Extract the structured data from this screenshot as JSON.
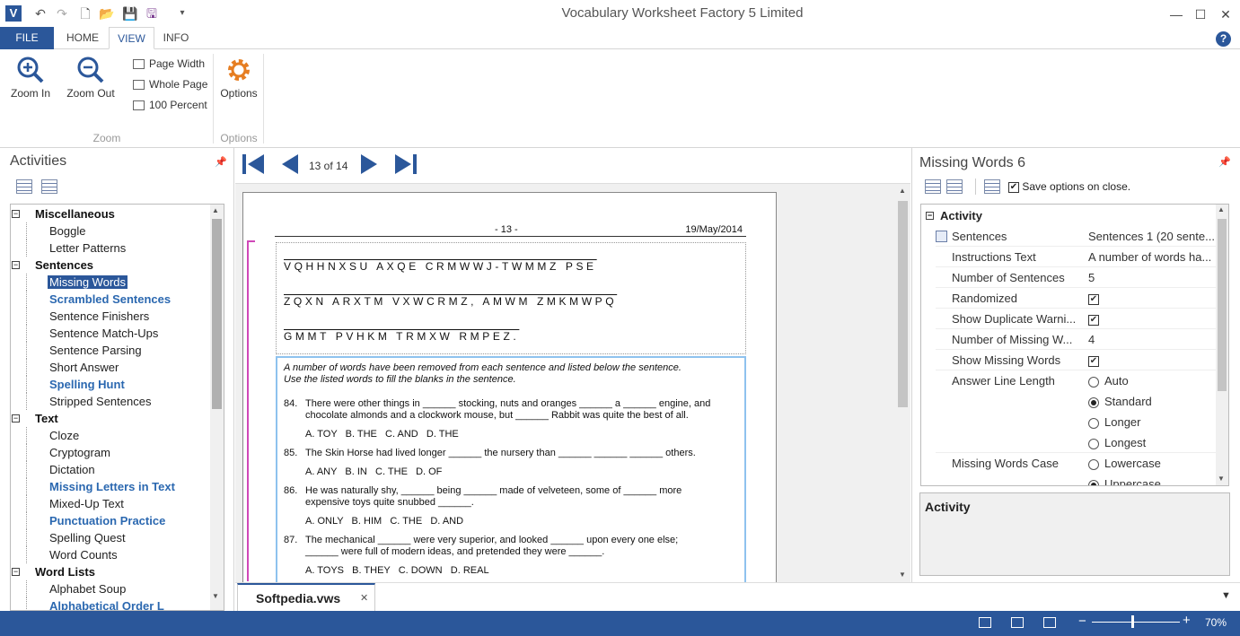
{
  "window": {
    "title": "Vocabulary Worksheet Factory 5 Limited",
    "app_icon": "V",
    "accent": "#2b579a"
  },
  "qat": {
    "icons": [
      "undo-icon",
      "redo-icon",
      "new-icon",
      "open-icon",
      "save-icon",
      "save-as-icon",
      "customize-icon"
    ]
  },
  "tabs": {
    "file": "FILE",
    "home": "HOME",
    "view": "VIEW",
    "info": "INFO",
    "active": "VIEW"
  },
  "ribbon": {
    "zoom_in": "Zoom In",
    "zoom_out": "Zoom Out",
    "page_width": "Page Width",
    "whole_page": "Whole Page",
    "percent_100": "100 Percent",
    "zoom_group": "Zoom",
    "options": "Options",
    "options_group": "Options"
  },
  "activities": {
    "title": "Activities",
    "tree": [
      {
        "label": "Miscellaneous",
        "kind": "category"
      },
      {
        "label": "Boggle",
        "kind": "item"
      },
      {
        "label": "Letter Patterns",
        "kind": "item"
      },
      {
        "label": "Sentences",
        "kind": "category"
      },
      {
        "label": "Missing Words",
        "kind": "selected"
      },
      {
        "label": "Scrambled Sentences",
        "kind": "bold"
      },
      {
        "label": "Sentence Finishers",
        "kind": "item"
      },
      {
        "label": "Sentence Match-Ups",
        "kind": "item"
      },
      {
        "label": "Sentence Parsing",
        "kind": "item"
      },
      {
        "label": "Short Answer",
        "kind": "item"
      },
      {
        "label": "Spelling Hunt",
        "kind": "bold"
      },
      {
        "label": "Stripped Sentences",
        "kind": "item"
      },
      {
        "label": "Text",
        "kind": "category"
      },
      {
        "label": "Cloze",
        "kind": "item"
      },
      {
        "label": "Cryptogram",
        "kind": "item"
      },
      {
        "label": "Dictation",
        "kind": "item"
      },
      {
        "label": "Missing Letters in Text",
        "kind": "bold"
      },
      {
        "label": "Mixed-Up Text",
        "kind": "item"
      },
      {
        "label": "Punctuation Practice",
        "kind": "bold"
      },
      {
        "label": "Spelling Quest",
        "kind": "item"
      },
      {
        "label": "Word Counts",
        "kind": "item"
      },
      {
        "label": "Word Lists",
        "kind": "category"
      },
      {
        "label": "Alphabet Soup",
        "kind": "item"
      },
      {
        "label": "Alphabetical Order L",
        "kind": "bold"
      }
    ]
  },
  "nav": {
    "page_indicator": "13 of 14"
  },
  "document": {
    "page_num": "- 13 -",
    "date": "19/May/2014",
    "cipher_lines": [
      "VQHHNXSU AXQE CRMWWJ-TWMMZ PSE",
      "ZQXN ARXTM VXWCRMZ, AMWM ZMKMWPQ",
      "GMMT PVHKM TRMXW RMPEZ."
    ],
    "instructions": [
      "A number of words have been removed from each sentence and listed below the sentence.",
      "Use the listed words to fill the blanks in the sentence."
    ],
    "questions": [
      {
        "num": "84.",
        "lines": [
          "There were other things in ______ stocking, nuts and oranges ______ a ______ engine, and",
          "chocolate almonds and a clockwork mouse, but ______ Rabbit was quite the best of all."
        ],
        "options": "A. TOY   B. THE   C. AND   D. THE"
      },
      {
        "num": "85.",
        "lines": [
          "The Skin Horse had lived longer ______ the nursery than ______ ______ ______ others."
        ],
        "options": "A. ANY   B. IN   C. THE   D. OF"
      },
      {
        "num": "86.",
        "lines": [
          "He was naturally shy, ______ being ______ made of velveteen, some of ______ more",
          "expensive toys quite snubbed ______."
        ],
        "options": "A. ONLY   B. HIM   C. THE   D. AND"
      },
      {
        "num": "87.",
        "lines": [
          "The mechanical ______ were very superior, and looked ______ upon every one else;",
          "______ were full of modern ideas, and pretended they were ______."
        ],
        "options": "A. TOYS   B. THEY   C. DOWN   D. REAL"
      }
    ]
  },
  "doc_tab": {
    "name": "Softpedia.vws"
  },
  "properties": {
    "title": "Missing Words 6",
    "save_on_close": "Save options on close.",
    "save_on_close_checked": true,
    "category": "Activity",
    "rows": [
      {
        "name": "Sentences",
        "value": "Sentences 1 (20 sente..."
      },
      {
        "name": "Instructions Text",
        "value": "A number of words ha..."
      },
      {
        "name": "Number of Sentences",
        "value": "5"
      },
      {
        "name": "Randomized",
        "value": "✔"
      },
      {
        "name": "Show Duplicate Warni...",
        "value": "✔"
      },
      {
        "name": "Number of Missing W...",
        "value": "4"
      },
      {
        "name": "Show Missing Words",
        "value": "✔"
      }
    ],
    "answer_line_length": {
      "name": "Answer Line Length",
      "options": [
        "Auto",
        "Standard",
        "Longer",
        "Longest"
      ],
      "selected": "Standard"
    },
    "missing_words_case": {
      "name": "Missing Words Case",
      "options": [
        "Lowercase",
        "Uppercase"
      ],
      "selected": "Uppercase"
    },
    "description_title": "Activity"
  },
  "status": {
    "zoom": "70%"
  }
}
